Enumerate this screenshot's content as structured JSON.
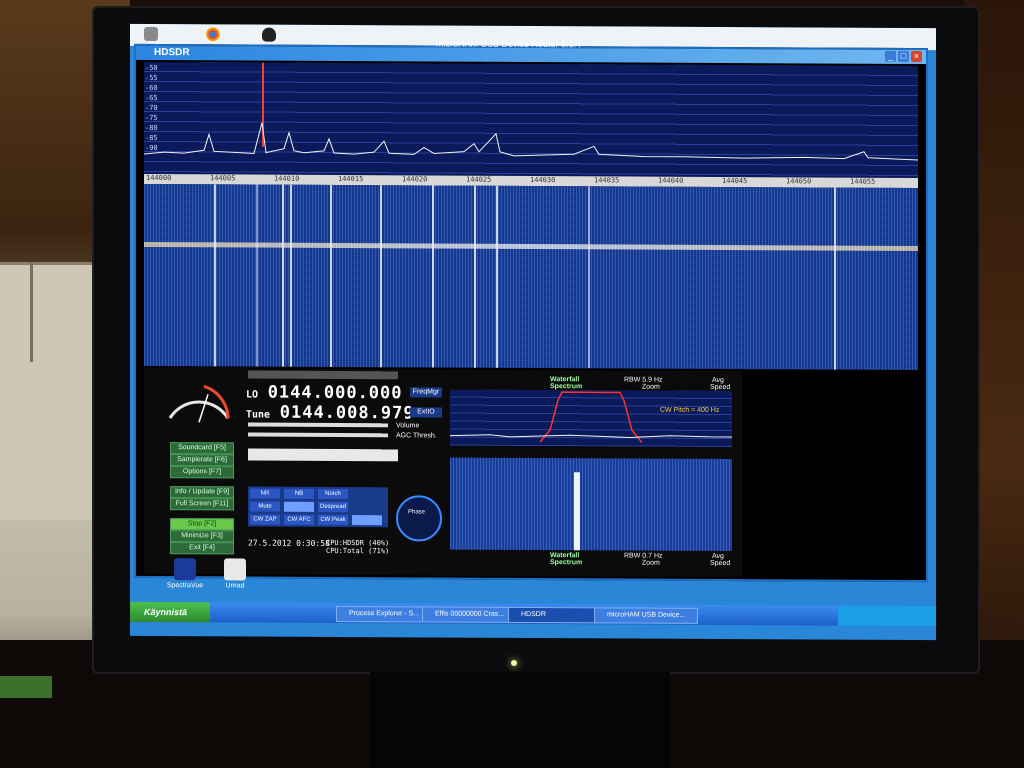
{
  "window": {
    "app_title": "HDSDR",
    "title_text": "microHAM USB Device Router 8.1.4"
  },
  "spectrum": {
    "db_scale": [
      "-50",
      "-55",
      "-60",
      "-65",
      "-70",
      "-75",
      "-80",
      "-85",
      "-90"
    ],
    "freq_ticks": [
      "144000",
      "144005",
      "144010",
      "144015",
      "144020",
      "144025",
      "144030",
      "144035",
      "144040",
      "144045",
      "144050",
      "144055"
    ]
  },
  "controls": {
    "lo_label": "LO",
    "lo_value": "0144.000.000",
    "tune_label": "Tune",
    "tune_value": "0144.008.979",
    "freqmgr": "FreqMgr",
    "extio": "ExtIO",
    "volume": "Volume",
    "agc": "AGC Thresh.",
    "buttons": [
      "Soundcard [F5]",
      "Samplerate [F6]",
      "Options [F7]",
      "Info / Update [F9]",
      "Full Screen [F11]",
      "Stop [F2]",
      "Minimize [F3]",
      "Exit [F4]"
    ],
    "dsp": [
      "NR",
      "NB",
      "Notch",
      "Mute",
      "",
      "Despread",
      "CW ZAP",
      "CW AFC",
      "CW Peak",
      ""
    ],
    "datetime": "27.5.2012 0:30:58",
    "cpu_hdsdr": "CPU:HDSDR (40%)",
    "cpu_total": "CPU:Total (71%)",
    "compass_label": "Phase"
  },
  "zoom": {
    "waterfall": "Waterfall",
    "spectrum": "Spectrum",
    "rbw_top": "RBW  5.9 Hz",
    "rbw_bottom": "RBW  0.7 Hz",
    "zoom": "Zoom",
    "avg": "Avg",
    "speed": "Speed",
    "cw_pitch": "CW Pitch = 400 Hz"
  },
  "desktop": {
    "icons": [
      "SpectraVue",
      "Unrad"
    ]
  },
  "taskbar": {
    "start": "Käynnistä",
    "tasks": [
      "Process Explorer - S...",
      "Effis 00000000 Cras...",
      "HDSDR",
      "microHAM USB Device..."
    ]
  },
  "colors": {
    "lcd_text": "#a8e890",
    "accent": "#2b86e0"
  }
}
